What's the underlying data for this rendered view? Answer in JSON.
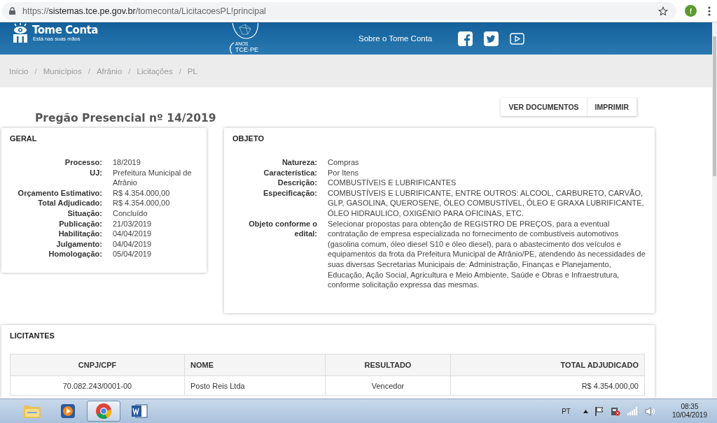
{
  "browser": {
    "url": "https://sistemas.tce.pe.gov.br/tomeconta/LicitacoesPL!principal",
    "profile_initial": "f"
  },
  "header": {
    "brand": "Tome Conta",
    "tagline": "Está nas suas mãos",
    "emblem_small": "ANOS",
    "emblem_text": "TCE·PE",
    "nav_link": "Sobre o Tome Conta"
  },
  "breadcrumb": {
    "separator": "/",
    "items": [
      {
        "label": "Início"
      },
      {
        "label": "Municípios"
      },
      {
        "label": "Afrânio"
      },
      {
        "label": "Licitações"
      },
      {
        "label": "PL"
      }
    ]
  },
  "title": "Pregão Presencial nº 14/2019",
  "buttons": [
    "VER DOCUMENTOS",
    "IMPRIMIR"
  ],
  "geral": {
    "heading": "GERAL",
    "fields": [
      {
        "label": "Processo:",
        "value": "18/2019"
      },
      {
        "label": "UJ:",
        "value": "Prefeitura Municipal de Afrânio"
      },
      {
        "label": "Orçamento Estimativo:",
        "value": "R$ 4.354.000,00"
      },
      {
        "label": "Total Adjudicado:",
        "value": "R$ 4.354.000,00"
      },
      {
        "label": "Situação:",
        "value": "Concluído"
      },
      {
        "label": "Publicação:",
        "value": "21/03/2019"
      },
      {
        "label": "Habilitação:",
        "value": "04/04/2019"
      },
      {
        "label": "Julgamento:",
        "value": "04/04/2019"
      },
      {
        "label": "Homologação:",
        "value": "05/04/2019"
      }
    ]
  },
  "objeto": {
    "heading": "OBJETO",
    "fields": [
      {
        "label": "Natureza:",
        "value": "Compras"
      },
      {
        "label": "Característica:",
        "value": "Por Itens"
      },
      {
        "label": "Descrição:",
        "value": "COMBUSTÍVEIS E LUBRIFICANTES"
      },
      {
        "label": "Especificação:",
        "value": "COMBUSTÍVEIS E LUBRIFICANTE, ENTRE OUTROS: ALCOOL, CARBURETO, CARVÃO, GLP, GASOLINA, QUEROSENE, ÓLEO COMBUSTÍVEL, ÓLEO E GRAXA LUBRIFICANTE, ÓLEO HIDRAULICO, OXIGÊNIO PARA OFICINAS, ETC."
      },
      {
        "label": "Objeto conforme o edital:",
        "value": "Selecionar propostas para obtenção de REGISTRO DE PREÇOS, para a eventual contratação de empresa especializada no fornecimento de combustíveis automotivos (gasolina comum, óleo diesel S10 e óleo diesel), para o abastecimento dos veículos e equipamentos da frota da Prefeitura Municipal de Afrânio/PE, atendendo às necessidades de suas diversas Secretarias Municipais de: Administração, Finanças e Planejamento, Educação, Ação Social, Agricultura e Meio Ambiente, Saúde e Obras e Infraestrutura, conforme solicitação expressa das mesmas."
      }
    ]
  },
  "licitantes": {
    "heading": "LICITANTES",
    "columns": [
      {
        "label": "CNPJ/CPF"
      },
      {
        "label": "NOME"
      },
      {
        "label": "RESULTADO"
      },
      {
        "label": "TOTAL ADJUDICADO"
      }
    ],
    "rows": [
      [
        "70.082.243/0001-00",
        "Posto Reis Ltda",
        "Vencedor",
        "R$ 4.354.000,00"
      ]
    ]
  },
  "taskbar": {
    "apps": [
      {
        "kind": "folder",
        "selected": false
      },
      {
        "kind": "media",
        "selected": false
      },
      {
        "kind": "chrome",
        "selected": true
      },
      {
        "kind": "word",
        "selected": false
      }
    ],
    "tray": {
      "language": "PT",
      "time": "08:35",
      "date": "10/04/2019"
    }
  }
}
